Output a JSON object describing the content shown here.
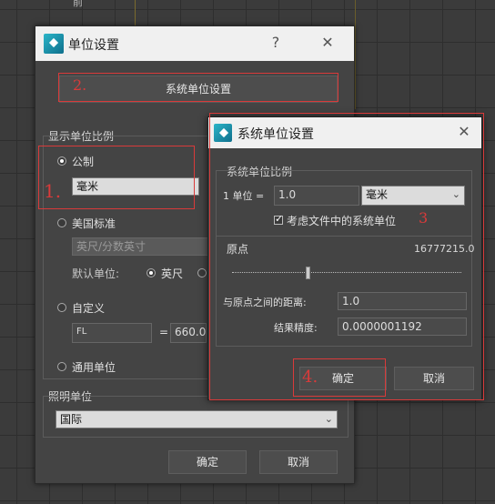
{
  "viewport": {
    "top_label": "前"
  },
  "units_dialog": {
    "title": "单位设置",
    "help": "?",
    "close": "✕",
    "system_unit_button": "系统单位设置",
    "display_scale_label": "显示单位比例",
    "metric_label": "公制",
    "metric_value": "毫米",
    "us_label": "美国标准",
    "us_value": "英尺/分数英寸",
    "default_unit_label": "默认单位:",
    "feet_label": "英尺",
    "custom_label": "自定义",
    "custom_name": "FL",
    "custom_equals": "=",
    "custom_value": "660.0",
    "generic_label": "通用单位",
    "lighting_label": "照明单位",
    "lighting_value": "国际",
    "ok": "确定",
    "cancel": "取消"
  },
  "system_dialog": {
    "title": "系统单位设置",
    "close": "✕",
    "scale_group_label": "系统单位比例",
    "one_unit_label": "1 单位 =",
    "unit_value": "1.0",
    "unit_type": "毫米",
    "consider_files_label": "考虑文件中的系统单位",
    "origin_label": "原点",
    "origin_value": "16777215.0",
    "slider_fraction": 0.33,
    "distance_label": "与原点之间的距离:",
    "distance_value": "1.0",
    "precision_label": "结果精度:",
    "precision_value": "0.0000001192",
    "ok": "确定",
    "cancel": "取消"
  },
  "annotations": {
    "note1": "1.",
    "note2": "2.",
    "note3": "3",
    "note4": "4."
  },
  "colors": {
    "annotation_red": "#d93a3a",
    "dialog_bg": "#444444",
    "titlebar": "#f0f0f0"
  }
}
